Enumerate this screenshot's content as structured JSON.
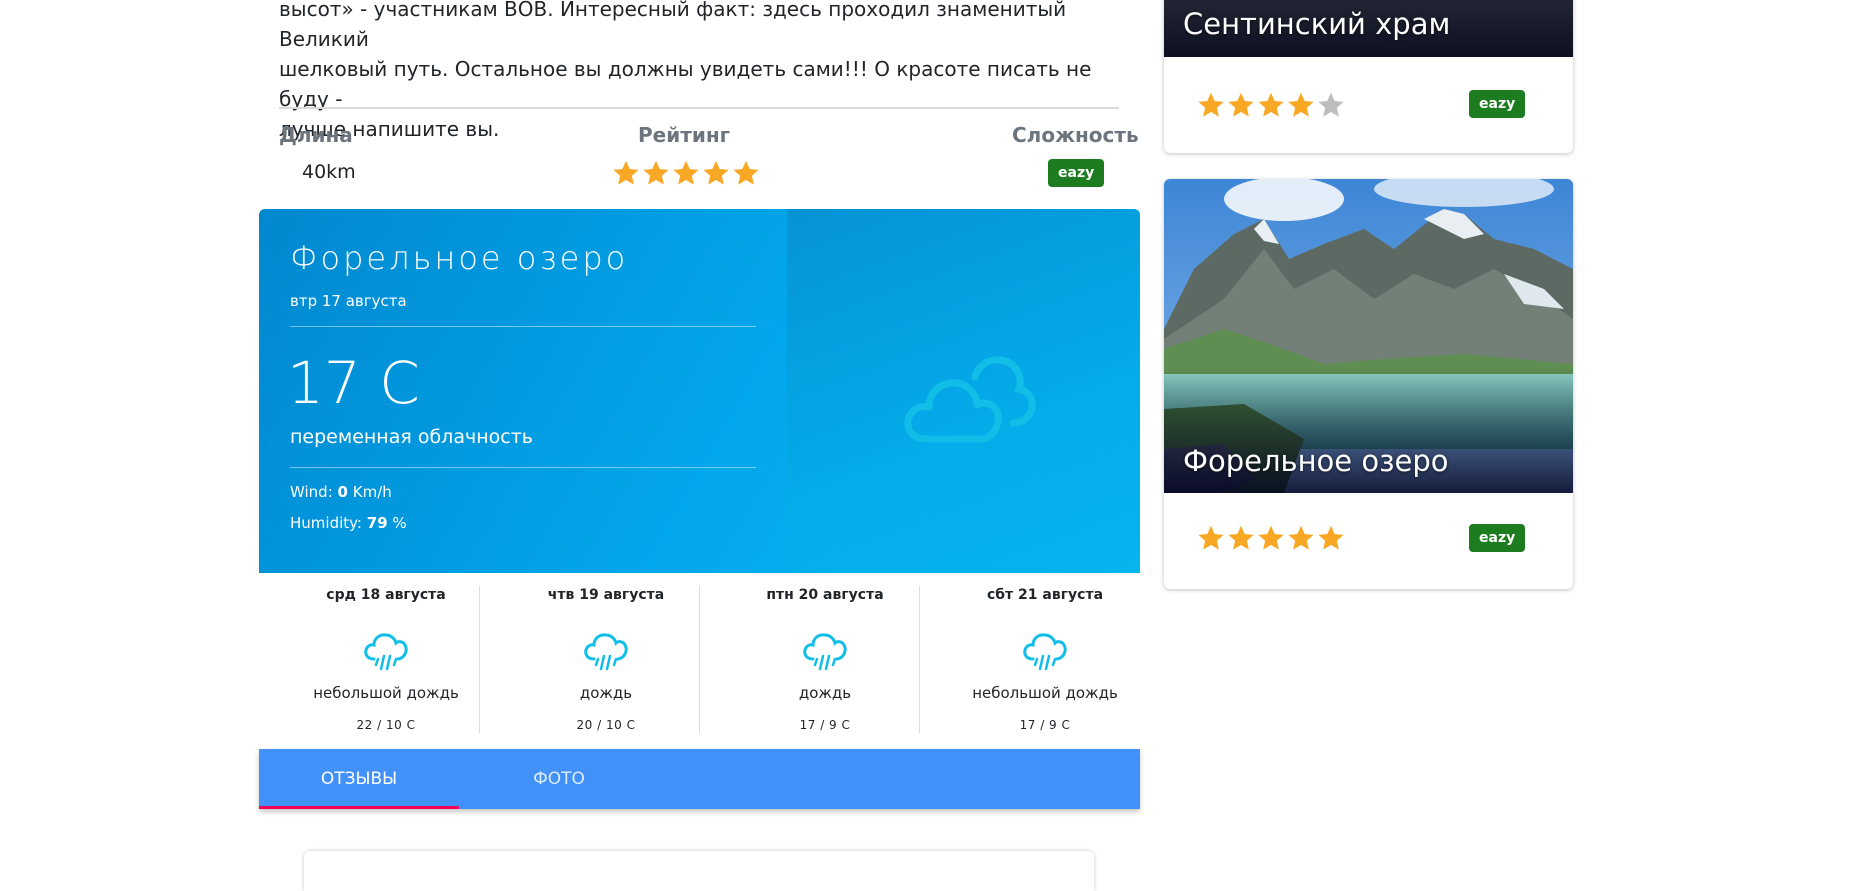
{
  "intro": {
    "line1": "высот» - участникам ВОВ. Интересный факт: здесь проходил знаменитый Великий",
    "line2": "шелковый путь. Остальное вы должны увидеть сами!!! О красоте писать не буду -",
    "line3": "лучше напишите вы."
  },
  "stats": {
    "length_label": "Длина",
    "length_value": "40km",
    "rating_label": "Рейтинг",
    "rating_value": 5,
    "difficulty_label": "Сложность",
    "difficulty_value": "eazy"
  },
  "weather": {
    "location": "Форельное озеро",
    "date": "втр 17 августа",
    "temperature": "17 C",
    "description": "переменная облачность",
    "wind_label": "Wind:",
    "wind_value": "0",
    "wind_unit": "Km/h",
    "humidity_label": "Humidity:",
    "humidity_value": "79",
    "humidity_unit": "%",
    "icon": "cloudy-icon",
    "forecast": [
      {
        "date": "срд 18 августа",
        "icon": "rain-icon",
        "description": "небольшой дождь",
        "temps": "22 / 10 C"
      },
      {
        "date": "чтв 19 августа",
        "icon": "rain-icon",
        "description": "дождь",
        "temps": "20 / 10 C"
      },
      {
        "date": "птн 20 августа",
        "icon": "rain-icon",
        "description": "дождь",
        "temps": "17 / 9 C"
      },
      {
        "date": "сбт 21 августа",
        "icon": "rain-icon",
        "description": "небольшой дождь",
        "temps": "17 / 9 C"
      }
    ]
  },
  "tabs": {
    "reviews": "ОТЗЫВЫ",
    "photos": "ФОТО",
    "active": "reviews"
  },
  "sidebar": {
    "cards": [
      {
        "title": "Сентинский храм",
        "rating": 4,
        "difficulty": "eazy"
      },
      {
        "title": "Форельное озеро",
        "rating": 5,
        "difficulty": "eazy"
      }
    ]
  },
  "colors": {
    "star": "#f8a825",
    "star_empty": "#bdbdbd",
    "badge": "#1c7c1f",
    "tab_bar": "#4191f8",
    "tab_indicator": "#f50057",
    "weather_icon": "#10bee8"
  }
}
